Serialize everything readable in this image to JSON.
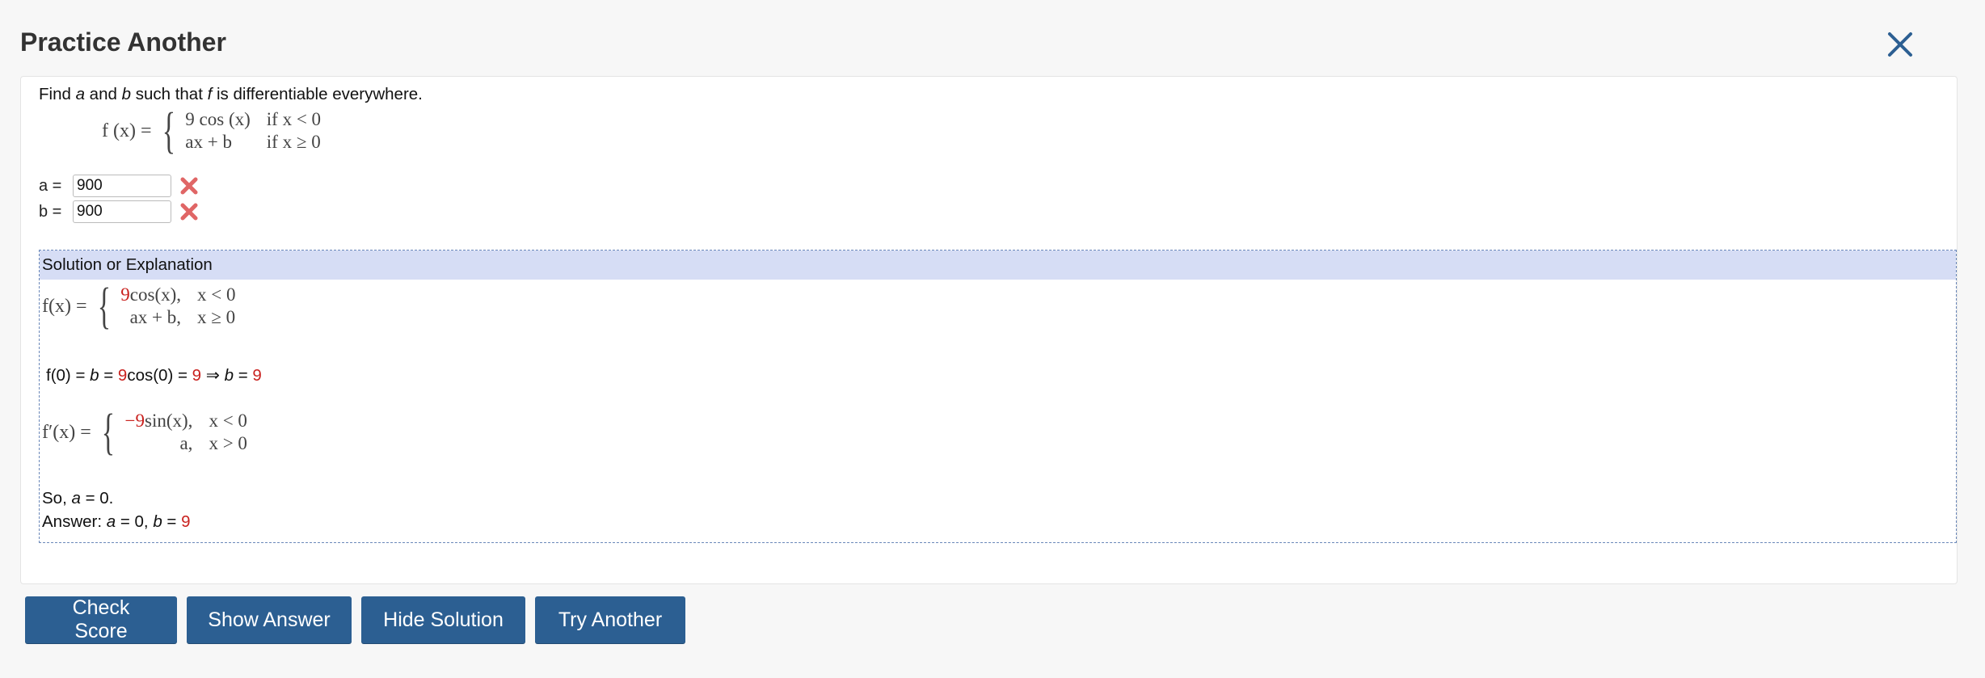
{
  "header": {
    "title": "Practice Another"
  },
  "problem": {
    "prompt_parts": [
      "Find ",
      "a",
      " and ",
      "b",
      " such that ",
      "f",
      " is differentiable everywhere."
    ],
    "function_def": {
      "lhs": "f (x) =",
      "cases": [
        {
          "expr": "9 cos (x)",
          "cond": "if x < 0"
        },
        {
          "expr": "ax + b",
          "cond": "if x ≥ 0"
        }
      ]
    },
    "fields": [
      {
        "label": "a =",
        "value": "900",
        "status": "incorrect"
      },
      {
        "label": "b =",
        "value": "900",
        "status": "incorrect"
      }
    ]
  },
  "solution": {
    "title": "Solution or Explanation",
    "f_def": {
      "lhs": "f(x) =",
      "cases": [
        {
          "coef": "9",
          "expr": "cos(x),",
          "cond": "x < 0"
        },
        {
          "coef": "",
          "expr": "ax + b,",
          "cond": "x ≥ 0"
        }
      ]
    },
    "step1_parts": [
      "f(0) = ",
      "b",
      " = ",
      "9",
      "cos(0) = ",
      "9",
      " ⇒ ",
      "b",
      " = ",
      "9"
    ],
    "fprime_def": {
      "lhs": "f′(x) =",
      "cases": [
        {
          "coef": "−9",
          "expr": "sin(x),",
          "cond": "x < 0"
        },
        {
          "coef": "",
          "expr": "a,",
          "cond": "x > 0"
        }
      ]
    },
    "so_line_parts": [
      "So, ",
      "a",
      " = 0."
    ],
    "answer_parts": [
      "Answer: ",
      "a",
      " = 0, ",
      "b",
      " = ",
      "9"
    ]
  },
  "buttons": {
    "check_score": "Check Score",
    "show_answer": "Show Answer",
    "hide_solution": "Hide Solution",
    "try_another": "Try Another"
  },
  "colors": {
    "accent": "#2c5f92",
    "highlight": "#c9211e",
    "solution_header": "#d6ddf5",
    "error": "#e06666"
  },
  "icons": {
    "close": "close-icon",
    "incorrect": "x-mark-icon"
  }
}
